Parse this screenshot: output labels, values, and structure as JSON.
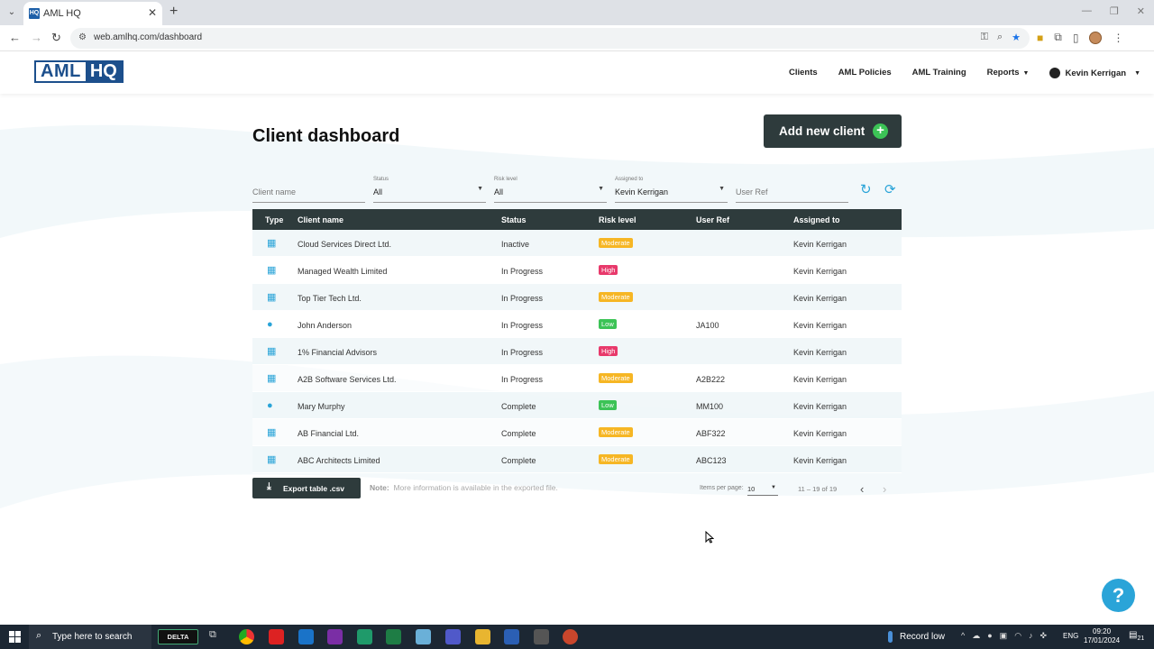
{
  "browser": {
    "tab_title": "AML HQ",
    "tab_favicon": "HQ",
    "url": "web.amlhq.com/dashboard"
  },
  "header": {
    "logo_aml": "AML",
    "logo_hq": "HQ",
    "nav": [
      "Clients",
      "AML Policies",
      "AML Training",
      "Reports"
    ],
    "user": "Kevin Kerrigan"
  },
  "dashboard": {
    "title": "Client dashboard",
    "add_button": "Add new client",
    "filters": {
      "client_name_placeholder": "Client name",
      "status_label": "Status",
      "status_value": "All",
      "risk_label": "Risk level",
      "risk_value": "All",
      "assigned_label": "Assigned to",
      "assigned_value": "Kevin Kerrigan",
      "user_ref_placeholder": "User Ref"
    },
    "columns": [
      "Type",
      "Client name",
      "Status",
      "Risk level",
      "User Ref",
      "Assigned to"
    ],
    "rows": [
      {
        "type": "company",
        "name": "Cloud Services Direct Ltd.",
        "status": "Inactive",
        "risk": "Moderate",
        "ref": "",
        "assigned": "Kevin Kerrigan"
      },
      {
        "type": "company",
        "name": "Managed Wealth Limited",
        "status": "In Progress",
        "risk": "High",
        "ref": "",
        "assigned": "Kevin Kerrigan"
      },
      {
        "type": "company",
        "name": "Top Tier Tech Ltd.",
        "status": "In Progress",
        "risk": "Moderate",
        "ref": "",
        "assigned": "Kevin Kerrigan"
      },
      {
        "type": "person",
        "name": "John Anderson",
        "status": "In Progress",
        "risk": "Low",
        "ref": "JA100",
        "assigned": "Kevin Kerrigan"
      },
      {
        "type": "company",
        "name": "1% Financial Advisors",
        "status": "In Progress",
        "risk": "High",
        "ref": "",
        "assigned": "Kevin Kerrigan"
      },
      {
        "type": "company",
        "name": "A2B Software Services Ltd.",
        "status": "In Progress",
        "risk": "Moderate",
        "ref": "A2B222",
        "assigned": "Kevin Kerrigan"
      },
      {
        "type": "person",
        "name": "Mary Murphy",
        "status": "Complete",
        "risk": "Low",
        "ref": "MM100",
        "assigned": "Kevin Kerrigan"
      },
      {
        "type": "company",
        "name": "AB Financial Ltd.",
        "status": "Complete",
        "risk": "Moderate",
        "ref": "ABF322",
        "assigned": "Kevin Kerrigan"
      },
      {
        "type": "company",
        "name": "ABC Architects Limited",
        "status": "Complete",
        "risk": "Moderate",
        "ref": "ABC123",
        "assigned": "Kevin Kerrigan"
      }
    ],
    "risk_colors": {
      "Moderate": "#f6b624",
      "High": "#e8396b",
      "Low": "#3cc356"
    },
    "export_button": "Export table .csv",
    "note_label": "Note:",
    "note_text": "More information is available in the exported file.",
    "items_per_page_label": "Items per page:",
    "items_per_page_value": "10",
    "range": "11 – 19 of 19"
  },
  "help_button": "?",
  "taskbar": {
    "search": "Type here to search",
    "delta": "DELTA",
    "weather": "Record low",
    "lang": "ENG",
    "time": "09:20",
    "date": "17/01/2024",
    "notifications": "21"
  }
}
